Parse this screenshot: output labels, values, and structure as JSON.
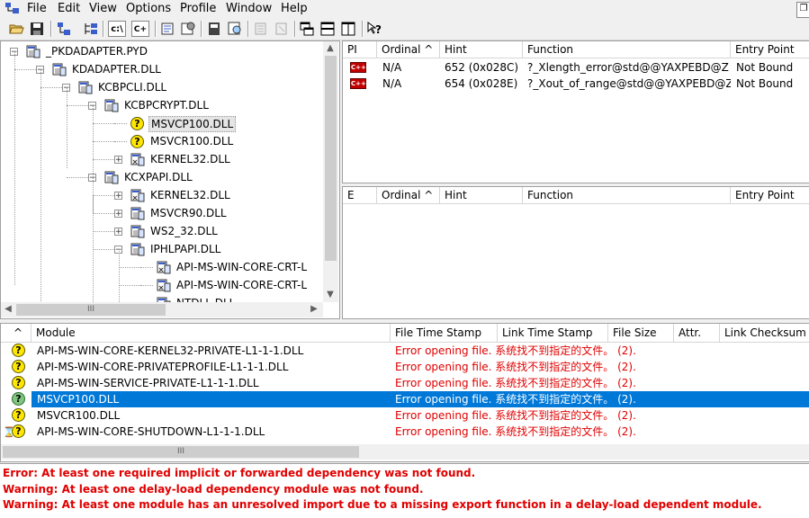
{
  "menu": [
    "File",
    "Edit",
    "View",
    "Options",
    "Profile",
    "Window",
    "Help"
  ],
  "toolbar": {
    "icons": [
      "open-icon",
      "save-icon",
      "module-tree-icon",
      "full-paths-icon",
      "decorate-functions-icon",
      "properties-icon",
      "find-icon",
      "copy-icon",
      "configure-icon",
      "tile-icon",
      "cascade-icon",
      "split-view-icon",
      "help-icon"
    ],
    "text_buttons": [
      "c:\\",
      "C+"
    ]
  },
  "tree": {
    "nodes": [
      {
        "label": "_PKDADAPTER.PYD",
        "depth": 0,
        "expander": "minus",
        "icon": "module"
      },
      {
        "label": "KDADAPTER.DLL",
        "depth": 1,
        "expander": "minus",
        "icon": "module"
      },
      {
        "label": "KCBPCLI.DLL",
        "depth": 2,
        "expander": "minus",
        "icon": "module"
      },
      {
        "label": "KCBPCRYPT.DLL",
        "depth": 3,
        "expander": "minus",
        "icon": "module"
      },
      {
        "label": "MSVCP100.DLL",
        "depth": 4,
        "expander": "none",
        "icon": "missing",
        "selected": true
      },
      {
        "label": "MSVCR100.DLL",
        "depth": 4,
        "expander": "none",
        "icon": "missing"
      },
      {
        "label": "KERNEL32.DLL",
        "depth": 4,
        "expander": "plus",
        "icon": "module-link"
      },
      {
        "label": "KCXPAPI.DLL",
        "depth": 3,
        "expander": "minus",
        "icon": "module"
      },
      {
        "label": "KERNEL32.DLL",
        "depth": 4,
        "expander": "plus",
        "icon": "module-link"
      },
      {
        "label": "MSVCR90.DLL",
        "depth": 4,
        "expander": "plus",
        "icon": "module"
      },
      {
        "label": "WS2_32.DLL",
        "depth": 4,
        "expander": "plus",
        "icon": "module"
      },
      {
        "label": "IPHLPAPI.DLL",
        "depth": 4,
        "expander": "minus",
        "icon": "module"
      },
      {
        "label": "API-MS-WIN-CORE-CRT-L",
        "depth": 5,
        "expander": "none",
        "icon": "module-link"
      },
      {
        "label": "API-MS-WIN-CORE-CRT-L",
        "depth": 5,
        "expander": "none",
        "icon": "module-link"
      },
      {
        "label": "NTDLL.DLL",
        "depth": 5,
        "expander": "none",
        "icon": "module-link"
      }
    ]
  },
  "imports": {
    "columns": [
      "PI",
      "Ordinal ^",
      "Hint",
      "Function",
      "Entry Point"
    ],
    "rows": [
      {
        "pi": "C++",
        "ordinal": "N/A",
        "hint": "652 (0x028C)",
        "function": "?_Xlength_error@std@@YAXPEBD@Z",
        "entry": "Not Bound"
      },
      {
        "pi": "C++",
        "ordinal": "N/A",
        "hint": "654 (0x028E)",
        "function": "?_Xout_of_range@std@@YAXPEBD@Z",
        "entry": "Not Bound"
      }
    ]
  },
  "exports": {
    "columns": [
      "E",
      "Ordinal ^",
      "Hint",
      "Function",
      "Entry Point"
    ]
  },
  "modules": {
    "columns": [
      "^",
      "Module",
      "File Time Stamp",
      "Link Time Stamp",
      "File Size",
      "Attr.",
      "Link Checksum"
    ],
    "rows": [
      {
        "icon": "yellow",
        "module": "API-MS-WIN-CORE-KERNEL32-PRIVATE-L1-1-1.DLL",
        "status": "Error opening file. 系统找不到指定的文件。 (2)."
      },
      {
        "icon": "yellow",
        "module": "API-MS-WIN-CORE-PRIVATEPROFILE-L1-1-1.DLL",
        "status": "Error opening file. 系统找不到指定的文件。 (2)."
      },
      {
        "icon": "yellow",
        "module": "API-MS-WIN-SERVICE-PRIVATE-L1-1-1.DLL",
        "status": "Error opening file. 系统找不到指定的文件。 (2)."
      },
      {
        "icon": "green",
        "module": "MSVCP100.DLL",
        "status": "Error opening file. 系统找不到指定的文件。 (2).",
        "selected": true
      },
      {
        "icon": "yellow",
        "module": "MSVCR100.DLL",
        "status": "Error opening file. 系统找不到指定的文件。 (2)."
      },
      {
        "icon": "hourglass-yellow",
        "module": "API-MS-WIN-CORE-SHUTDOWN-L1-1-1.DLL",
        "status": "Error opening file. 系统找不到指定的文件。 (2)."
      }
    ]
  },
  "log": [
    "Error: At least one required implicit or forwarded dependency was not found.",
    "Warning: At least one delay-load dependency module was not found.",
    "Warning: At least one module has an unresolved import due to a missing export function in a delay-load dependent module."
  ],
  "colors": {
    "error": "#e00000",
    "selection": "#0078d7",
    "pi_icon": "#c00000"
  }
}
